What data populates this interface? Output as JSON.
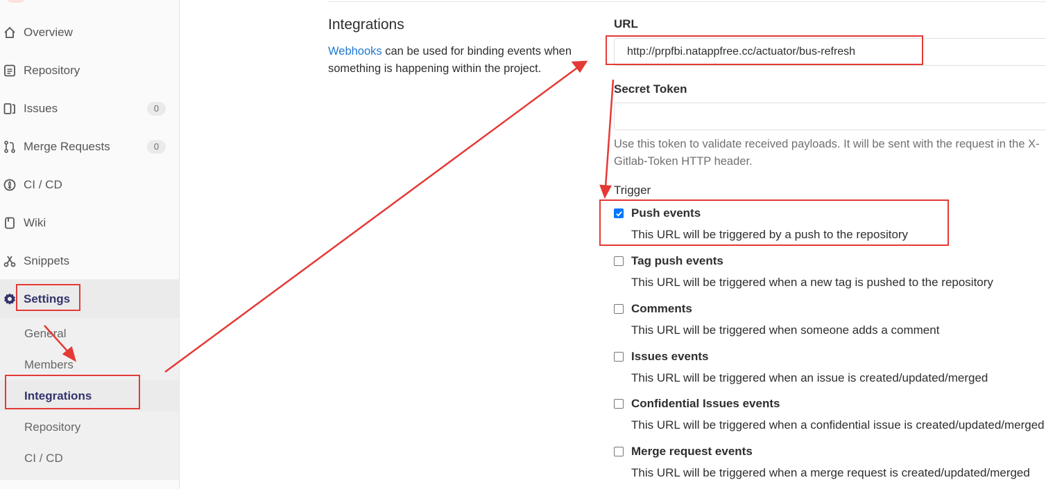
{
  "sidebar": {
    "items": [
      {
        "label": "Overview",
        "icon": "home-icon"
      },
      {
        "label": "Repository",
        "icon": "document-icon"
      },
      {
        "label": "Issues",
        "icon": "issues-icon",
        "badge": "0"
      },
      {
        "label": "Merge Requests",
        "icon": "merge-request-icon",
        "badge": "0"
      },
      {
        "label": "CI / CD",
        "icon": "rocket-icon"
      },
      {
        "label": "Wiki",
        "icon": "book-icon"
      },
      {
        "label": "Snippets",
        "icon": "scissors-icon"
      },
      {
        "label": "Settings",
        "icon": "gear-icon"
      }
    ],
    "settings_sub": [
      {
        "label": "General"
      },
      {
        "label": "Members"
      },
      {
        "label": "Integrations"
      },
      {
        "label": "Repository"
      },
      {
        "label": "CI / CD"
      }
    ]
  },
  "main": {
    "title": "Integrations",
    "desc_link": "Webhooks",
    "desc_rest": " can be used for binding events when something is happening within the project.",
    "url_label": "URL",
    "url_value": "http://prpfbi.natappfree.cc/actuator/bus-refresh",
    "secret_label": "Secret Token",
    "secret_value": "",
    "secret_help": "Use this token to validate received payloads. It will be sent with the request in the X-Gitlab-Token HTTP header.",
    "trigger_label": "Trigger",
    "triggers": [
      {
        "label": "Push events",
        "help": "This URL will be triggered by a push to the repository",
        "checked": true
      },
      {
        "label": "Tag push events",
        "help": "This URL will be triggered when a new tag is pushed to the repository",
        "checked": false
      },
      {
        "label": "Comments",
        "help": "This URL will be triggered when someone adds a comment",
        "checked": false
      },
      {
        "label": "Issues events",
        "help": "This URL will be triggered when an issue is created/updated/merged",
        "checked": false
      },
      {
        "label": "Confidential Issues events",
        "help": "This URL will be triggered when a confidential issue is created/updated/merged",
        "checked": false
      },
      {
        "label": "Merge request events",
        "help": "This URL will be triggered when a merge request is created/updated/merged",
        "checked": false
      }
    ]
  },
  "colors": {
    "annotation": "#e53935",
    "link": "#1f78d1",
    "checkbox_checked": "#0075ff"
  }
}
